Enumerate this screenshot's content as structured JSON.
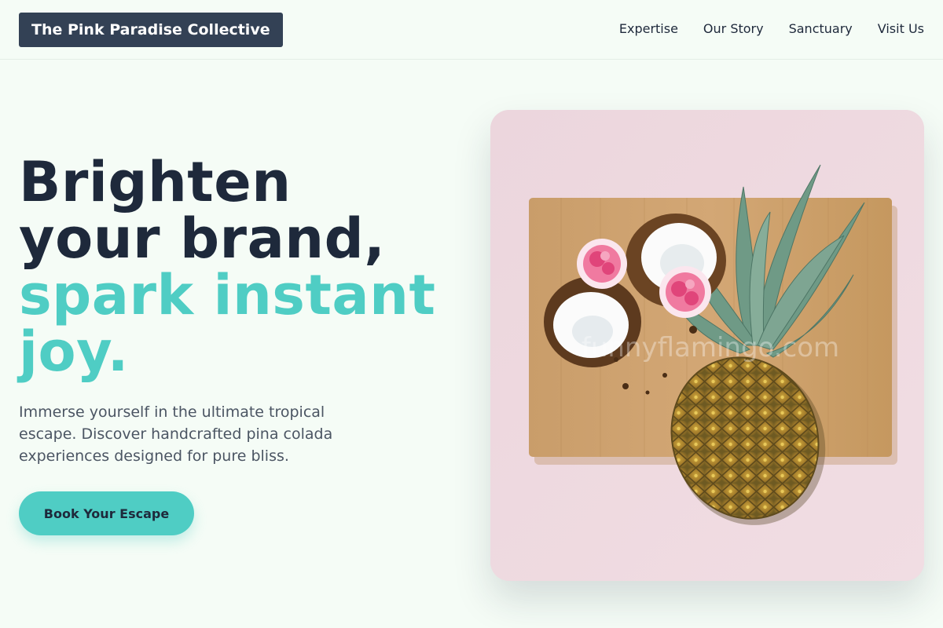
{
  "header": {
    "brand": "The Pink Paradise Collective",
    "nav": [
      "Expertise",
      "Our Story",
      "Sanctuary",
      "Visit Us"
    ]
  },
  "hero": {
    "headline_line1": "Brighten",
    "headline_line2": "your brand,",
    "headline_accent1": "spark instant",
    "headline_accent2": "joy.",
    "description": "Immerse yourself in the ultimate tropical escape. Discover handcrafted pina colada experiences designed for pure bliss.",
    "cta_label": "Book Your Escape",
    "image_watermark": "funnyflamingo.com"
  },
  "colors": {
    "background": "#f5fcf6",
    "brand_bg": "#334155",
    "accent": "#4fcdc4",
    "text_dark": "#1e293b",
    "text_muted": "#4b5563",
    "image_bg": "#eedbe2"
  }
}
